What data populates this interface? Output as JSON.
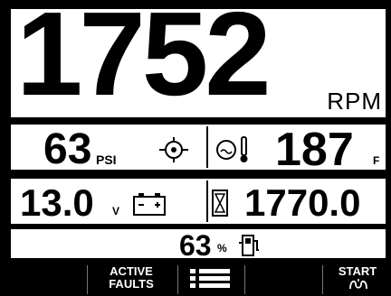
{
  "rpm": {
    "value": "1752",
    "unit": "RPM"
  },
  "oil_pressure": {
    "value": "63",
    "unit": "PSI",
    "icon": "oil-pressure-icon"
  },
  "coolant_temp": {
    "value": "187",
    "unit": "F",
    "icon": "coolant-temp-icon"
  },
  "battery": {
    "value": "13.0",
    "unit": "V",
    "icon": "battery-icon"
  },
  "engine_hours": {
    "value": "1770.0",
    "icon": "hourglass-icon"
  },
  "fuel": {
    "value": "63",
    "unit": "%",
    "icon": "fuel-pump-icon"
  },
  "softkeys": {
    "faults_label": "ACTIVE\nFAULTS",
    "menu_icon": "menu-list-icon",
    "start_label": "START",
    "start_icon": "glow-plug-icon"
  },
  "colors": {
    "background": "#000000",
    "panel": "#ffffff",
    "text": "#000000",
    "softkey_text": "#ffffff"
  }
}
